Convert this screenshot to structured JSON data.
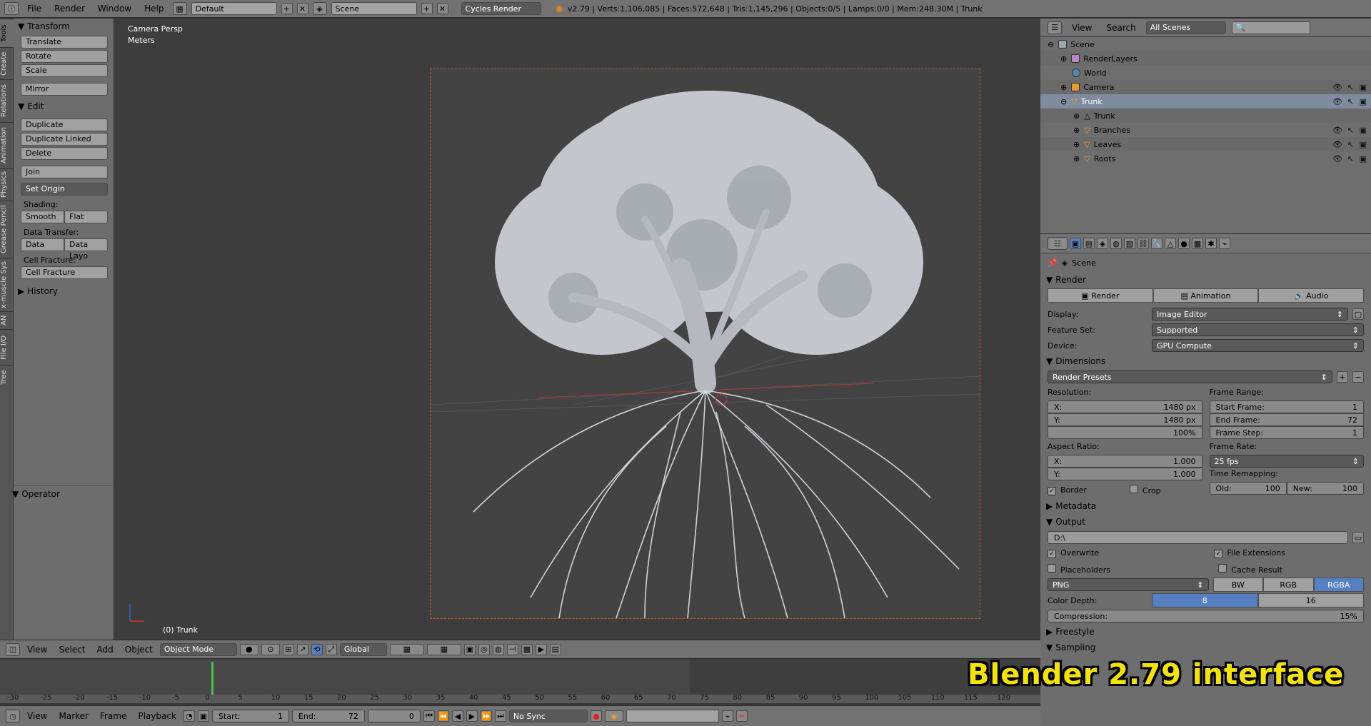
{
  "topbar": {
    "menus": [
      "File",
      "Render",
      "Window",
      "Help"
    ],
    "layout": "Default",
    "scene": "Scene",
    "engine": "Cycles Render",
    "stats": "v2.79 | Verts:1,106,085 | Faces:572,648 | Tris:1,145,296 | Objects:0/5 | Lamps:0/0 | Mem:248.30M | Trunk"
  },
  "left_tabs": [
    "Tools",
    "Create",
    "Relations",
    "Animation",
    "Physics",
    "Grease Pencil",
    "x-muscle Sys",
    "AN",
    "File I/O",
    "Tree"
  ],
  "toolshelf": {
    "transform_title": "Transform",
    "translate": "Translate",
    "rotate": "Rotate",
    "scale": "Scale",
    "mirror": "Mirror",
    "edit_title": "Edit",
    "duplicate": "Duplicate",
    "duplicate_linked": "Duplicate Linked",
    "delete": "Delete",
    "join": "Join",
    "set_origin": "Set Origin",
    "shading_label": "Shading:",
    "smooth": "Smooth",
    "flat": "Flat",
    "data_transfer_label": "Data Transfer:",
    "data": "Data",
    "data_layo": "Data Layo",
    "cell_fracture_label": "Cell Fracture:",
    "cell_fracture": "Cell Fracture",
    "history": "History",
    "operator": "Operator"
  },
  "viewport": {
    "view_name": "Camera Persp",
    "units": "Meters",
    "object_label": "(0) Trunk"
  },
  "vp_header": {
    "menus": [
      "View",
      "Select",
      "Add",
      "Object"
    ],
    "mode": "Object Mode",
    "orientation": "Global"
  },
  "timeline": {
    "ticks": [
      "-30",
      "-25",
      "-20",
      "-15",
      "-10",
      "-5",
      "0",
      "5",
      "10",
      "15",
      "20",
      "25",
      "30",
      "35",
      "40",
      "45",
      "50",
      "55",
      "60",
      "65",
      "70",
      "75",
      "80",
      "85",
      "90",
      "95",
      "100",
      "105",
      "110",
      "115",
      "120"
    ],
    "menus": [
      "View",
      "Marker",
      "Frame",
      "Playback"
    ],
    "start_label": "Start:",
    "start": "1",
    "end_label": "End:",
    "end": "72",
    "current": "0",
    "sync": "No Sync"
  },
  "outliner": {
    "menus": [
      "View",
      "Search"
    ],
    "scenes": "All Scenes",
    "items": [
      {
        "label": "Scene",
        "indent": 0
      },
      {
        "label": "RenderLayers",
        "indent": 1
      },
      {
        "label": "World",
        "indent": 1
      },
      {
        "label": "Camera",
        "indent": 1
      },
      {
        "label": "Trunk",
        "indent": 1
      },
      {
        "label": "Trunk",
        "indent": 2
      },
      {
        "label": "Branches",
        "indent": 2
      },
      {
        "label": "Leaves",
        "indent": 2
      },
      {
        "label": "Roots",
        "indent": 2
      }
    ]
  },
  "props": {
    "context": "Scene",
    "render_title": "Render",
    "render_btn": "Render",
    "animation_btn": "Animation",
    "audio_btn": "Audio",
    "display_label": "Display:",
    "display": "Image Editor",
    "feature_label": "Feature Set:",
    "feature": "Supported",
    "device_label": "Device:",
    "device": "GPU Compute",
    "dimensions_title": "Dimensions",
    "presets": "Render Presets",
    "resolution_label": "Resolution:",
    "res_x_label": "X:",
    "res_x": "1480 px",
    "res_y_label": "Y:",
    "res_y": "1480 px",
    "res_pct": "100%",
    "frame_range_label": "Frame Range:",
    "start_frame_label": "Start Frame:",
    "start_frame": "1",
    "end_frame_label": "End Frame:",
    "end_frame": "72",
    "frame_step_label": "Frame Step:",
    "frame_step": "1",
    "aspect_label": "Aspect Ratio:",
    "asp_x_label": "X:",
    "asp_x": "1.000",
    "asp_y_label": "Y:",
    "asp_y": "1.000",
    "frame_rate_label": "Frame Rate:",
    "fps": "25 fps",
    "time_remap_label": "Time Remapping:",
    "old_label": "Old:",
    "old": "100",
    "new_label": "New:",
    "new": "100",
    "border": "Border",
    "crop": "Crop",
    "metadata_title": "Metadata",
    "output_title": "Output",
    "output_path": "D:\\",
    "overwrite": "Overwrite",
    "file_extensions": "File Extensions",
    "placeholders": "Placeholders",
    "cache_result": "Cache Result",
    "format": "PNG",
    "bw": "BW",
    "rgb": "RGB",
    "rgba": "RGBA",
    "color_depth_label": "Color Depth:",
    "depth_8": "8",
    "depth_16": "16",
    "compression_label": "Compression:",
    "compression": "15%",
    "freestyle_title": "Freestyle",
    "sampling_title": "Sampling"
  },
  "watermark": "Blender 2.79 interface",
  "colors": {
    "accent": "#5680c2",
    "watermark": "#f5e400",
    "camera_border": "#c8523c"
  }
}
